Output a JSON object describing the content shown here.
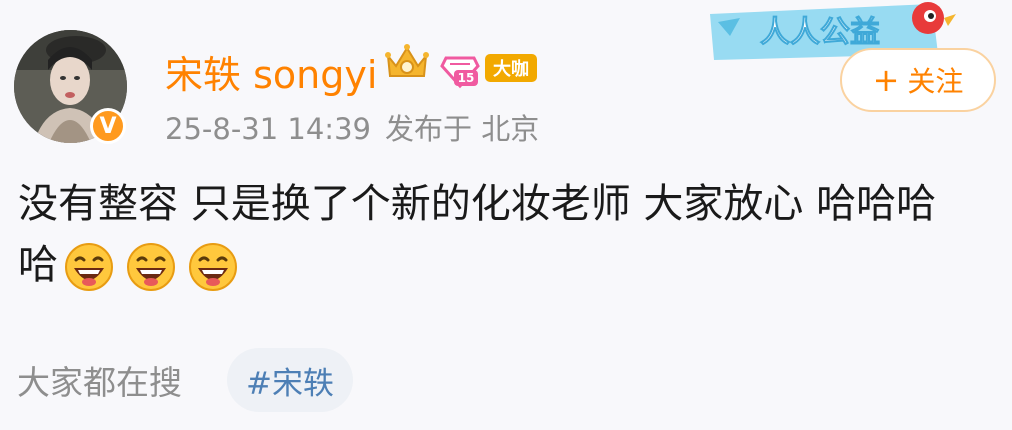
{
  "user": {
    "name": "宋轶 songyi",
    "verified_mark": "V",
    "vip_level": "15",
    "big_badge": "大咖"
  },
  "post": {
    "timestamp": "25-8-31 14:39",
    "source_label": "发布于 北京",
    "text": "没有整容 只是换了个新的化妆老师 大家放心 哈哈哈哈",
    "emoji_names": [
      "laughing-emoji",
      "laughing-emoji",
      "laughing-emoji"
    ]
  },
  "banner": {
    "text": "人人公益"
  },
  "actions": {
    "follow_plus": "+",
    "follow_label": "关注"
  },
  "search": {
    "label": "大家都在搜",
    "tag": "#宋轶"
  },
  "colors": {
    "username": "#ff8200",
    "meta": "#8e8e8e",
    "tag_text": "#4d7fb5",
    "tag_bg": "#eef1f6",
    "follow_border": "#fad2a0",
    "verified": "#ff9a1f",
    "banner": "#7fd3f0"
  }
}
